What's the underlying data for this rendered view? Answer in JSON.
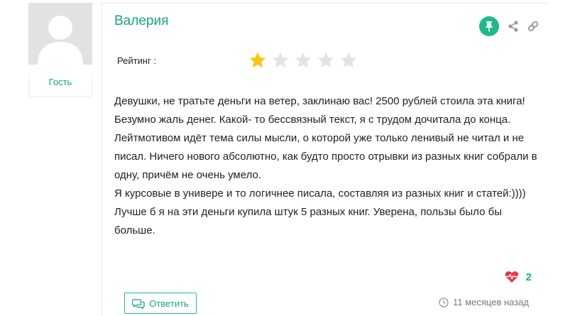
{
  "author": {
    "name": "Валерия",
    "role": "Гость",
    "avatar_icon": "default-user-avatar"
  },
  "actions": {
    "pin_icon": "pin-icon",
    "share_icon": "share-icon",
    "link_icon": "link-icon",
    "accent_color": "#1fb98c"
  },
  "rating": {
    "label": "Рейтинг :",
    "value": 1,
    "max": 5,
    "filled_color": "#f3c712",
    "empty_color": "#e3e3e3"
  },
  "review": {
    "paragraphs": [
      "Девушки, не тратьте деньги на ветер, заклинаю вас! 2500 рублей стоила эта книга! Безумно жаль денег. Какой- то бессвязный текст, я с трудом дочитала до конца. Лейтмотивом идёт тема силы мысли, о которой уже только ленивый не читал и не писал. Ничего нового абсолютно, как будто просто отрывки из разных книг собрали в одну, причём не очень умело.",
      "Я курсовые в универе и то логичнее писала, составляя из разных книг и статей:))))",
      "Лучше б я на эти деньги купила штук 5 разных книг. Уверена, пользы было бы больше."
    ]
  },
  "likes": {
    "count": "2",
    "icon": "heartbeat-icon",
    "icon_color": "#e8364a"
  },
  "footer": {
    "reply_label": "Ответить",
    "reply_icon": "comments-icon",
    "time_icon": "clock-icon",
    "time_text": "11 месяцев назад"
  }
}
